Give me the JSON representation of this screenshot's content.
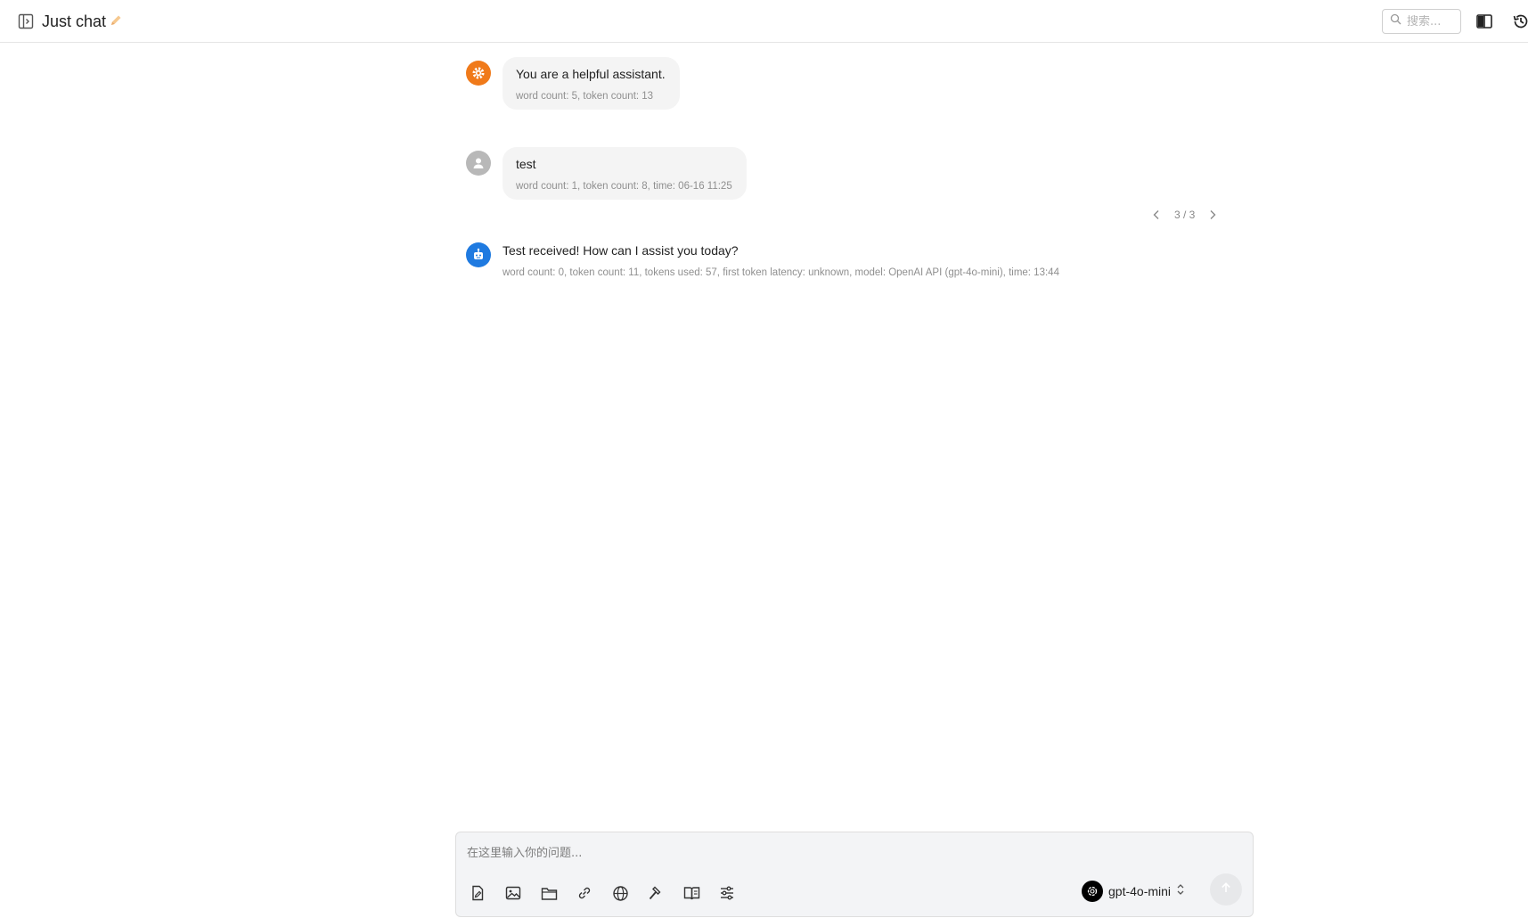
{
  "header": {
    "title": "Just chat",
    "search_placeholder": "搜索..."
  },
  "messages": [
    {
      "role": "system",
      "avatar_icon": "gear-icon",
      "avatar_color": "#f07a1a",
      "text": "You are a helpful assistant.",
      "meta": "word count: 5, token count: 13"
    },
    {
      "role": "user",
      "avatar_icon": "person-icon",
      "avatar_color": "#b8b8b8",
      "text": "test",
      "meta": "word count: 1, token count: 8, time: 06-16 11:25"
    },
    {
      "role": "assistant",
      "avatar_icon": "robot-icon",
      "avatar_color": "#1f7ae0",
      "text": "Test received! How can I assist you today?",
      "meta": "word count: 0, token count: 11, tokens used: 57, first token latency: unknown, model: OpenAI API (gpt-4o-mini), time: 13:44"
    }
  ],
  "pager": {
    "label": "3 / 3"
  },
  "composer": {
    "placeholder": "在这里输入你的问题...",
    "tools": [
      "edit-document-icon",
      "image-icon",
      "folder-icon",
      "link-icon",
      "globe-icon",
      "hammer-icon",
      "book-icon",
      "sliders-icon"
    ],
    "model": "gpt-4o-mini"
  }
}
